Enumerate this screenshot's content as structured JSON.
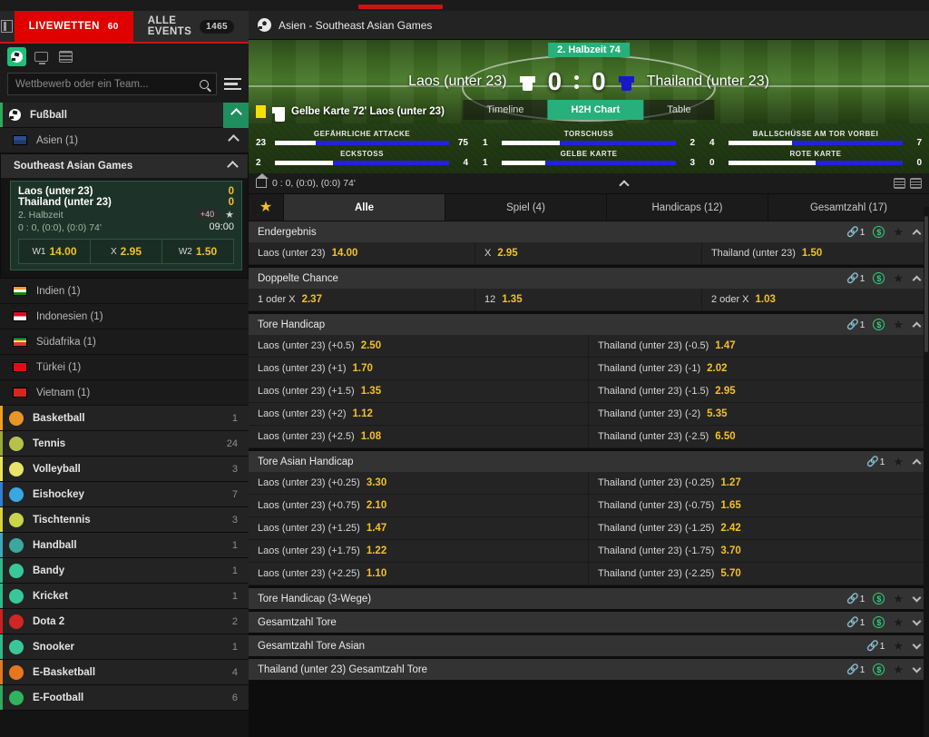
{
  "sidebar": {
    "tabs": [
      {
        "label": "LIVEWETTEN",
        "count": "60",
        "active": true
      },
      {
        "label": "ALLE EVENTS",
        "count": "1465",
        "active": false
      }
    ],
    "view_icons": [
      "soccer-ball-icon",
      "monitor-icon",
      "list-icon"
    ],
    "search": {
      "placeholder": "Wettbewerb oder ein Team...",
      "value": "",
      "icon": "search-icon"
    },
    "filter_icon": "filter-lines-icon",
    "sport_header": {
      "label": "Fußball",
      "icon": "soccer-ball-icon"
    },
    "region": {
      "label": "Asien (1)",
      "icon": "asia-flag-icon"
    },
    "league": {
      "label": "Southeast Asian Games"
    },
    "match": {
      "team1": "Laos (unter 23)",
      "team2": "Thailand (unter 23)",
      "score1": "0",
      "score2": "0",
      "period": "2. Halbzeit",
      "badge": "+40",
      "detail": "0 : 0, (0:0), (0:0) 74'",
      "time": "09:00",
      "odds": [
        {
          "key": "W1",
          "value": "14.00"
        },
        {
          "key": "X",
          "value": "2.95"
        },
        {
          "key": "W2",
          "value": "1.50"
        }
      ]
    },
    "countries": [
      {
        "label": "Indien (1)",
        "flag": "india-flag-icon"
      },
      {
        "label": "Indonesien (1)",
        "flag": "indonesia-flag-icon"
      },
      {
        "label": "Südafrika (1)",
        "flag": "south-africa-flag-icon"
      },
      {
        "label": "Türkei (1)",
        "flag": "turkey-flag-icon"
      },
      {
        "label": "Vietnam (1)",
        "flag": "vietnam-flag-icon"
      }
    ],
    "sports": [
      {
        "label": "Basketball",
        "count": "1",
        "accent": "#f0a020",
        "icon": "basketball-icon",
        "icon_color": "#e8962a"
      },
      {
        "label": "Tennis",
        "count": "24",
        "accent": "#9aa83a",
        "icon": "tennis-ball-icon",
        "icon_color": "#b5c24a"
      },
      {
        "label": "Volleyball",
        "count": "3",
        "accent": "#e8e45a",
        "icon": "volleyball-icon",
        "icon_color": "#e6e46a"
      },
      {
        "label": "Eishockey",
        "count": "7",
        "accent": "#2f7fd0",
        "icon": "hockey-puck-icon",
        "icon_color": "#39a7e0"
      },
      {
        "label": "Tischtennis",
        "count": "3",
        "accent": "#d8d23a",
        "icon": "table-tennis-icon",
        "icon_color": "#c9d44a"
      },
      {
        "label": "Handball",
        "count": "1",
        "accent": "#3aa9c0",
        "icon": "handball-icon",
        "icon_color": "#3ba8a0"
      },
      {
        "label": "Bandy",
        "count": "1",
        "accent": "#2fb98a",
        "icon": "bandy-stick-icon",
        "icon_color": "#39c79a"
      },
      {
        "label": "Kricket",
        "count": "1",
        "accent": "#2fb98a",
        "icon": "cricket-bat-icon",
        "icon_color": "#39c79a"
      },
      {
        "label": "Dota 2",
        "count": "2",
        "accent": "#cc2020",
        "icon": "dota2-icon",
        "icon_color": "#d02626"
      },
      {
        "label": "Snooker",
        "count": "1",
        "accent": "#2fb98a",
        "icon": "snooker-cue-icon",
        "icon_color": "#39c79a"
      },
      {
        "label": "E-Basketball",
        "count": "4",
        "accent": "#e07a20",
        "icon": "e-basketball-icon",
        "icon_color": "#e8761f"
      },
      {
        "label": "E-Football",
        "count": "6",
        "accent": "#2fa95a",
        "icon": "e-football-icon",
        "icon_color": "#2fb45e"
      }
    ]
  },
  "main": {
    "breadcrumb": "Asien - Southeast Asian Games",
    "scoreboard": {
      "period_badge": "2. Halbzeit 74",
      "home_team": "Laos (unter 23)",
      "away_team": "Thailand (unter 23)",
      "home_score": "0",
      "away_score": "0",
      "home_shirt_color": "#ffffff",
      "away_shirt_color": "#1818c8",
      "event_text": "Gelbe Karte 72' Laos (unter 23)",
      "event_card_color": "#f5e000",
      "view_tabs": [
        {
          "label": "Timeline",
          "active": false
        },
        {
          "label": "H2H Chart",
          "active": true
        },
        {
          "label": "Table",
          "active": false
        }
      ]
    },
    "status_line": "0 : 0, (0:0), (0:0) 74'",
    "market_tabs": [
      {
        "label": "Alle",
        "active": true
      },
      {
        "label": "Spiel (4)",
        "active": false
      },
      {
        "label": "Handicaps (12)",
        "active": false
      },
      {
        "label": "Gesamtzahl (17)",
        "active": false
      }
    ],
    "markets": [
      {
        "title": "Endergebnis",
        "link_count": "1",
        "has_dollar": true,
        "expanded": true,
        "cols": 3,
        "selections": [
          {
            "name": "Laos (unter 23)",
            "odd": "14.00"
          },
          {
            "name": "X",
            "odd": "2.95"
          },
          {
            "name": "Thailand (unter 23)",
            "odd": "1.50"
          }
        ]
      },
      {
        "title": "Doppelte Chance",
        "link_count": "1",
        "has_dollar": true,
        "expanded": true,
        "cols": 3,
        "selections": [
          {
            "name": "1 oder X",
            "odd": "2.37"
          },
          {
            "name": "12",
            "odd": "1.35"
          },
          {
            "name": "2 oder X",
            "odd": "1.03"
          }
        ]
      },
      {
        "title": "Tore Handicap",
        "link_count": "1",
        "has_dollar": true,
        "expanded": true,
        "cols": 2,
        "selections": [
          {
            "name": "Laos (unter 23) (+0.5)",
            "odd": "2.50"
          },
          {
            "name": "Thailand (unter 23) (-0.5)",
            "odd": "1.47"
          },
          {
            "name": "Laos (unter 23) (+1)",
            "odd": "1.70"
          },
          {
            "name": "Thailand (unter 23) (-1)",
            "odd": "2.02"
          },
          {
            "name": "Laos (unter 23) (+1.5)",
            "odd": "1.35"
          },
          {
            "name": "Thailand (unter 23) (-1.5)",
            "odd": "2.95"
          },
          {
            "name": "Laos (unter 23) (+2)",
            "odd": "1.12"
          },
          {
            "name": "Thailand (unter 23) (-2)",
            "odd": "5.35"
          },
          {
            "name": "Laos (unter 23) (+2.5)",
            "odd": "1.08"
          },
          {
            "name": "Thailand (unter 23) (-2.5)",
            "odd": "6.50"
          }
        ]
      },
      {
        "title": "Tore Asian Handicap",
        "link_count": "1",
        "has_dollar": false,
        "expanded": true,
        "cols": 2,
        "selections": [
          {
            "name": "Laos (unter 23) (+0.25)",
            "odd": "3.30"
          },
          {
            "name": "Thailand (unter 23) (-0.25)",
            "odd": "1.27"
          },
          {
            "name": "Laos (unter 23) (+0.75)",
            "odd": "2.10"
          },
          {
            "name": "Thailand (unter 23) (-0.75)",
            "odd": "1.65"
          },
          {
            "name": "Laos (unter 23) (+1.25)",
            "odd": "1.47"
          },
          {
            "name": "Thailand (unter 23) (-1.25)",
            "odd": "2.42"
          },
          {
            "name": "Laos (unter 23) (+1.75)",
            "odd": "1.22"
          },
          {
            "name": "Thailand (unter 23) (-1.75)",
            "odd": "3.70"
          },
          {
            "name": "Laos (unter 23) (+2.25)",
            "odd": "1.10"
          },
          {
            "name": "Thailand (unter 23) (-2.25)",
            "odd": "5.70"
          }
        ]
      },
      {
        "title": "Tore Handicap (3-Wege)",
        "link_count": "1",
        "has_dollar": true,
        "expanded": false,
        "cols": 3,
        "selections": []
      },
      {
        "title": "Gesamtzahl Tore",
        "link_count": "1",
        "has_dollar": true,
        "expanded": false,
        "cols": 3,
        "selections": []
      },
      {
        "title": "Gesamtzahl Tore Asian",
        "link_count": "1",
        "has_dollar": false,
        "expanded": false,
        "cols": 3,
        "selections": []
      },
      {
        "title": "Thailand (unter 23) Gesamtzahl Tore",
        "link_count": "1",
        "has_dollar": true,
        "expanded": false,
        "cols": 3,
        "selections": []
      }
    ]
  },
  "chart_data": {
    "type": "bar",
    "title": "H2H Chart",
    "orientation": "horizontal-split",
    "left_team": "Laos (unter 23)",
    "right_team": "Thailand (unter 23)",
    "left_color": "#ffffff",
    "right_color": "#2222dd",
    "categories": [
      "GEFÄHRLICHE ATTACKE",
      "TORSCHUSS",
      "BALLSCHÜSSE AM TOR VORBEI",
      "ECKSTOSS",
      "GELBE KARTE",
      "ROTE KARTE"
    ],
    "series": [
      {
        "name": "Laos (unter 23)",
        "values": [
          23,
          1,
          4,
          2,
          1,
          0
        ]
      },
      {
        "name": "Thailand (unter 23)",
        "values": [
          75,
          2,
          7,
          4,
          3,
          0
        ]
      }
    ]
  }
}
